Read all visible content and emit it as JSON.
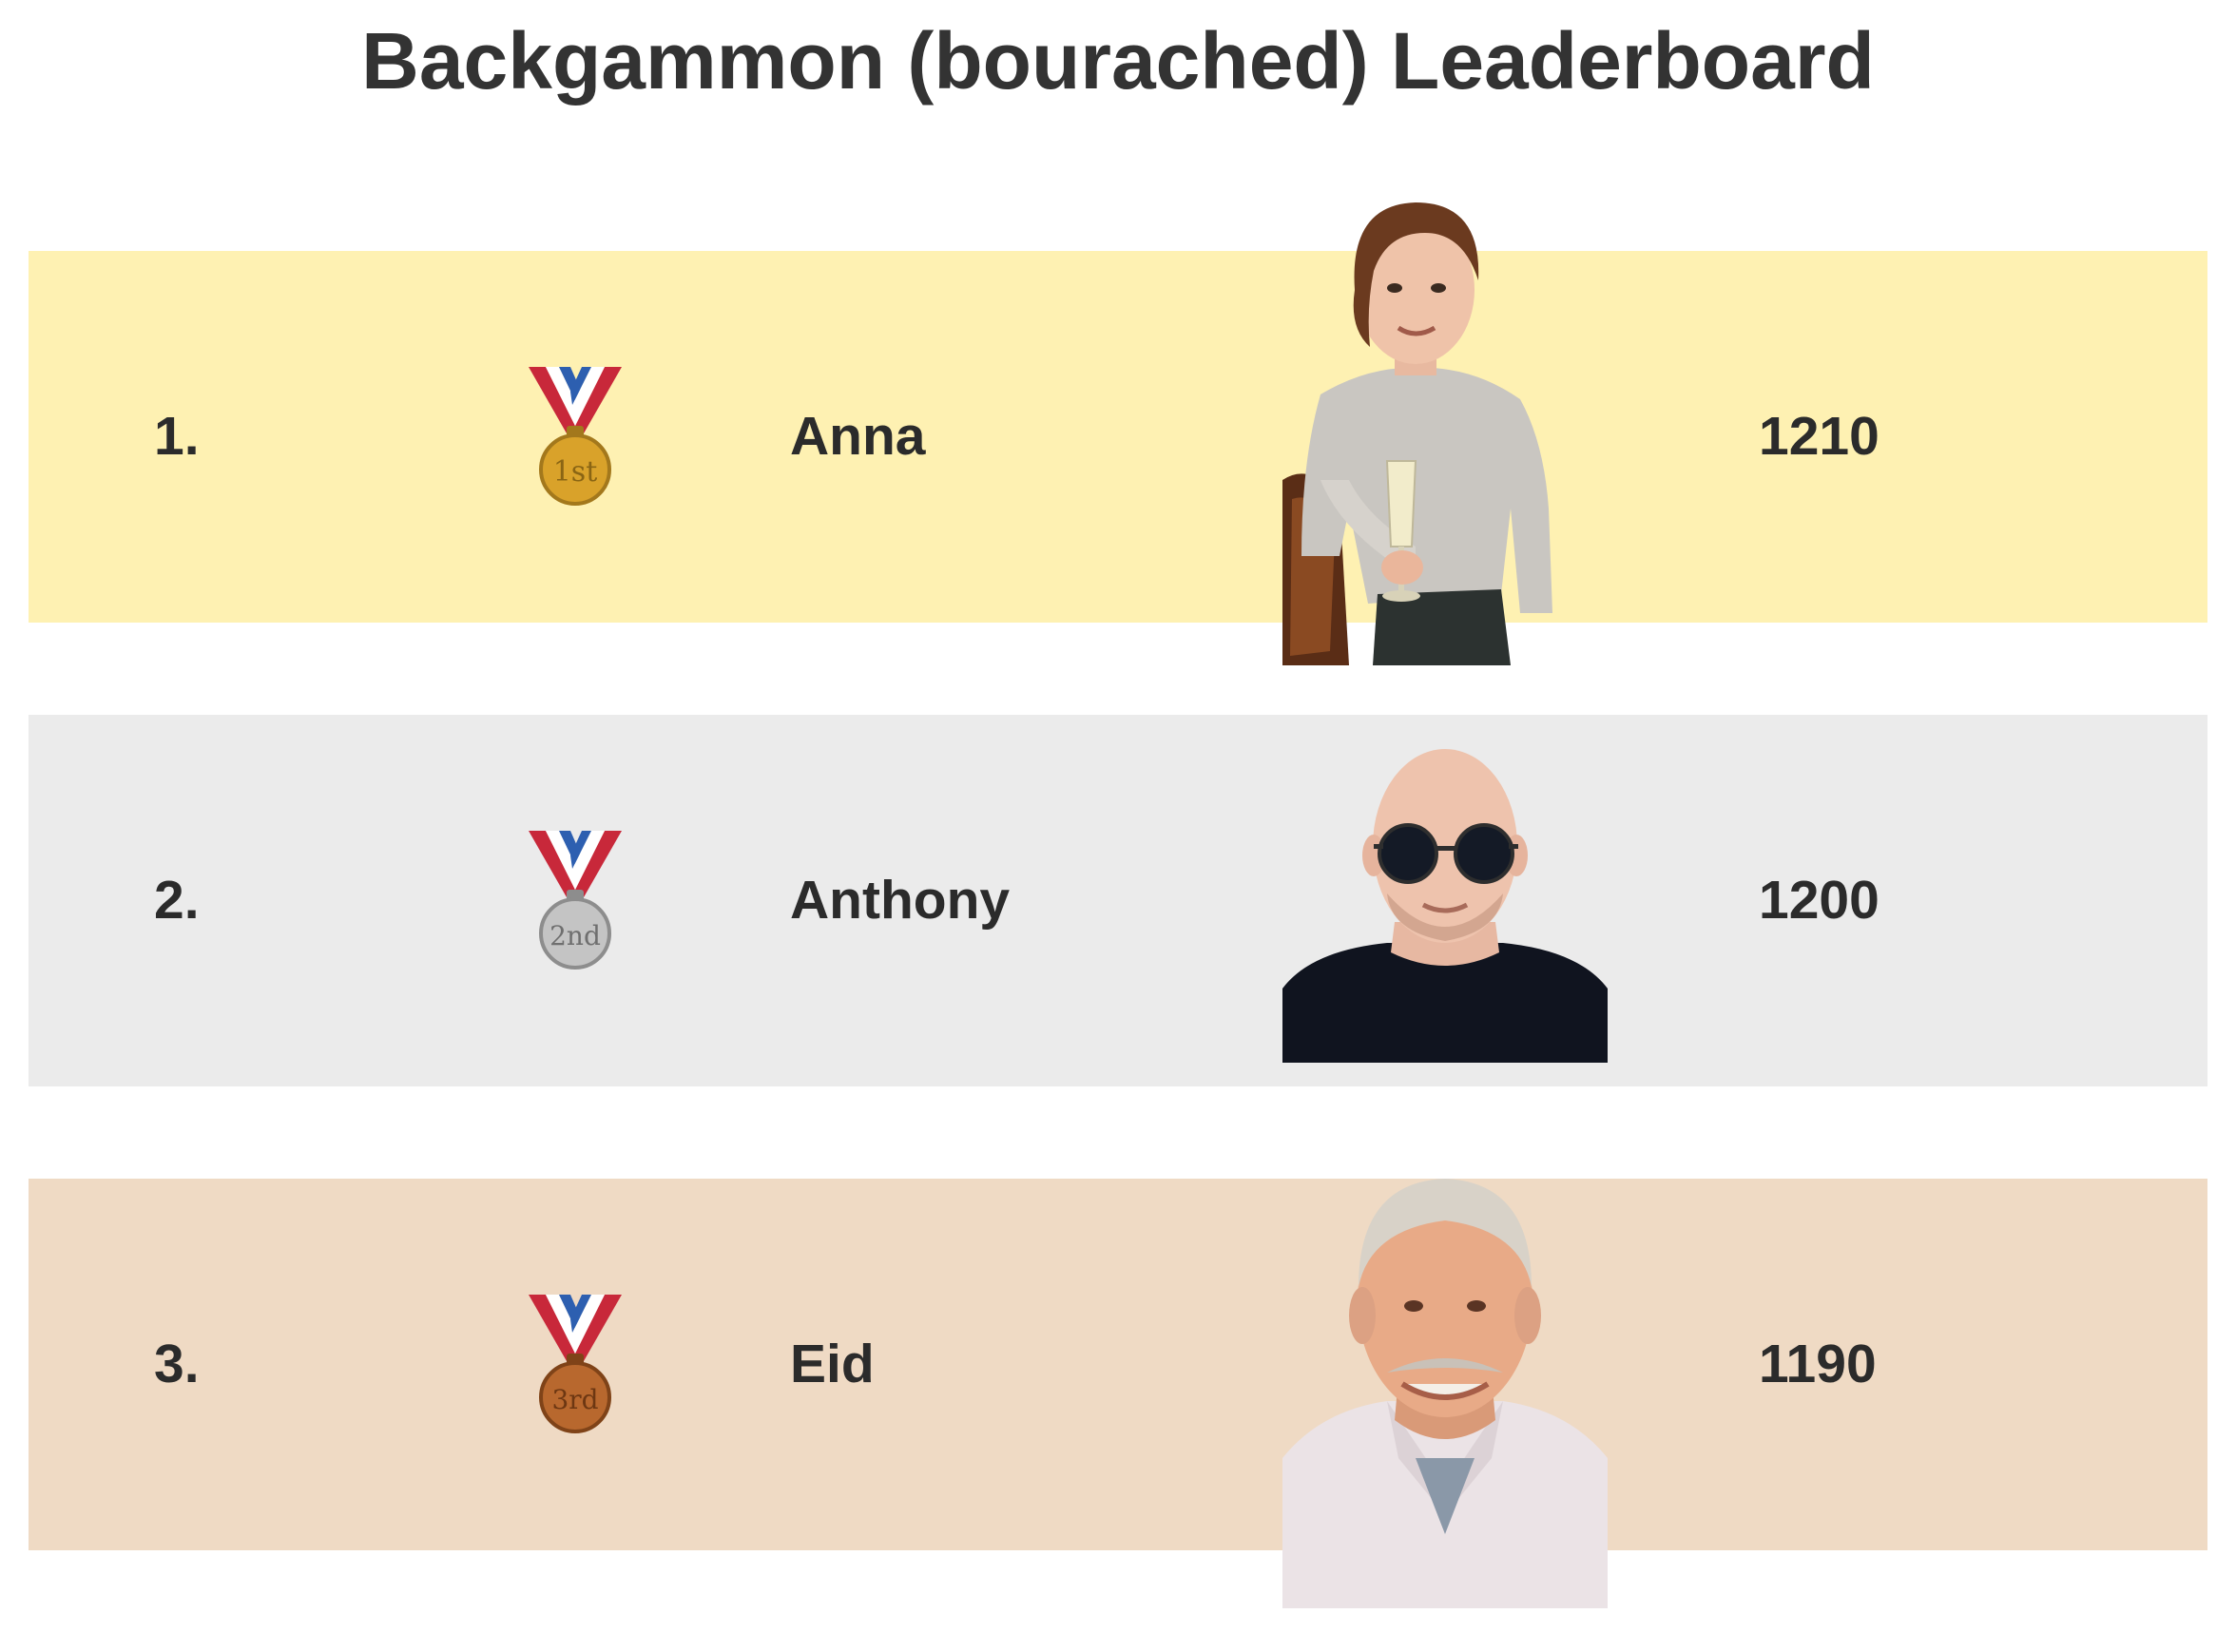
{
  "title": "Backgammon (bourached) Leaderboard",
  "entries": [
    {
      "rank": "1.",
      "medal": "first-place-medal-icon",
      "medal_text": "1st",
      "medal_color": "#d9a22a",
      "name": "Anna",
      "score": "1210",
      "row_color": "#fef1b2"
    },
    {
      "rank": "2.",
      "medal": "second-place-medal-icon",
      "medal_text": "2nd",
      "medal_color": "#b9b9b9",
      "name": "Anthony",
      "score": "1200",
      "row_color": "#ebebeb"
    },
    {
      "rank": "3.",
      "medal": "third-place-medal-icon",
      "medal_text": "3rd",
      "medal_color": "#b8682e",
      "name": "Eid",
      "score": "1190",
      "row_color": "#efdac4"
    }
  ]
}
